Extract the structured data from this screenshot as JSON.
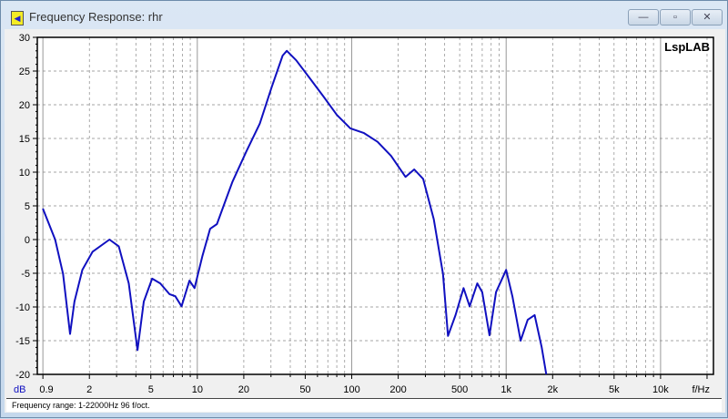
{
  "window": {
    "title": "Frequency Response: rhr",
    "buttons": {
      "minimize": "—",
      "maximize": "▫",
      "close": "✕"
    }
  },
  "status": "Frequency range: 1-22000Hz  96 f/oct.",
  "chart_data": {
    "type": "line",
    "title": "",
    "watermark": "LspLAB",
    "xlabel": "f/Hz",
    "ylabel": "dB",
    "xscale": "log",
    "xlim": [
      0.92,
      22000
    ],
    "ylim": [
      -20,
      30
    ],
    "xticks": [
      {
        "v": 0.9,
        "label": "0.9"
      },
      {
        "v": 2,
        "label": "2"
      },
      {
        "v": 5,
        "label": "5"
      },
      {
        "v": 10,
        "label": "10"
      },
      {
        "v": 20,
        "label": "20"
      },
      {
        "v": 50,
        "label": "50"
      },
      {
        "v": 100,
        "label": "100"
      },
      {
        "v": 200,
        "label": "200"
      },
      {
        "v": 500,
        "label": "500"
      },
      {
        "v": 1000,
        "label": "1k"
      },
      {
        "v": 2000,
        "label": "2k"
      },
      {
        "v": 5000,
        "label": "5k"
      },
      {
        "v": 10000,
        "label": "10k"
      }
    ],
    "yticks": [
      30,
      25,
      20,
      15,
      10,
      5,
      0,
      -5,
      -10,
      -15,
      -20
    ],
    "grid": true,
    "color": "#1010c0",
    "series": [
      {
        "name": "rhr",
        "x": [
          1,
          1.2,
          1.35,
          1.5,
          1.6,
          1.8,
          2.1,
          2.7,
          3.1,
          3.6,
          4.1,
          4.5,
          5.1,
          5.75,
          6.6,
          7.2,
          7.9,
          8.9,
          9.6,
          10.8,
          12.1,
          13.4,
          14.8,
          16.9,
          20.8,
          25.4,
          30.3,
          35.7,
          38,
          43.7,
          53.6,
          65.7,
          80,
          98,
          120,
          147,
          180,
          223,
          254,
          290,
          340,
          390,
          420,
          470,
          530,
          580,
          650,
          700,
          780,
          860,
          1000,
          1100,
          1240,
          1380,
          1530,
          1700,
          1820
        ],
        "y": [
          4.6,
          0,
          -5.1,
          -14,
          -9.2,
          -4.5,
          -1.8,
          0,
          -1,
          -6.5,
          -16.4,
          -9.2,
          -5.8,
          -6.5,
          -8.1,
          -8.4,
          -9.9,
          -6.1,
          -7.2,
          -2.4,
          1.6,
          2.3,
          5,
          8.6,
          13.1,
          17.2,
          22.6,
          27.3,
          28,
          26.6,
          23.9,
          21.2,
          18.5,
          16.5,
          15.8,
          14.5,
          12.4,
          9.3,
          10.4,
          9,
          3,
          -5.1,
          -14.3,
          -11.2,
          -7.2,
          -9.9,
          -6.5,
          -7.8,
          -14.2,
          -7.8,
          -4.5,
          -8.5,
          -15,
          -11.9,
          -11.2,
          -16,
          -20
        ]
      }
    ]
  }
}
